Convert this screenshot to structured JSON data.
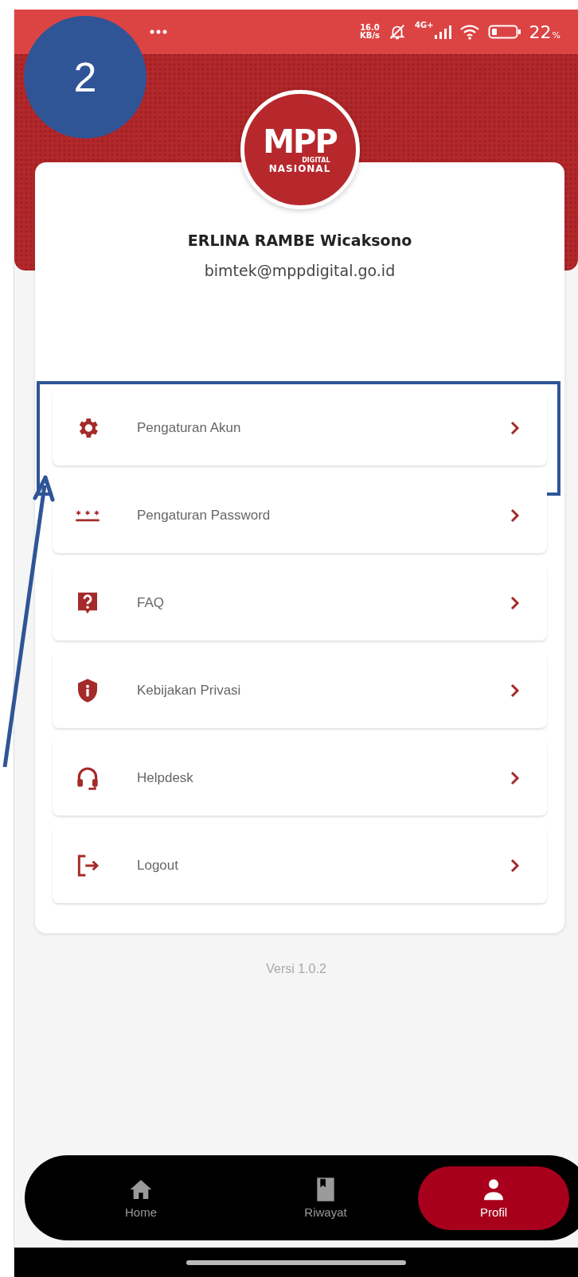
{
  "status_bar": {
    "speed": "16.0",
    "speed_unit": "KB/s",
    "network": "4G+",
    "battery": "22",
    "battery_unit": "%"
  },
  "step_badge": "2",
  "logo": {
    "title": "MPP",
    "subtitle": "DIGITAL",
    "caption": "NASIONAL"
  },
  "profile": {
    "name": "ERLINA RAMBE Wicaksono",
    "email": "bimtek@mppdigital.go.id"
  },
  "menu": [
    {
      "label": "Pengaturan Akun",
      "kind": "gear",
      "highlighted": true
    },
    {
      "label": "Pengaturan Password",
      "kind": "password",
      "highlighted": false
    },
    {
      "label": "FAQ",
      "kind": "question",
      "highlighted": false
    },
    {
      "label": "Kebijakan Privasi",
      "kind": "shield",
      "highlighted": false
    },
    {
      "label": "Helpdesk",
      "kind": "headset",
      "highlighted": false
    },
    {
      "label": "Logout",
      "kind": "logout",
      "highlighted": false
    }
  ],
  "version": "Versi 1.0.2",
  "nav": [
    {
      "label": "Home",
      "kind": "home",
      "selected": false
    },
    {
      "label": "Riwayat",
      "kind": "book",
      "selected": false
    },
    {
      "label": "Profil",
      "kind": "person",
      "selected": true
    }
  ]
}
